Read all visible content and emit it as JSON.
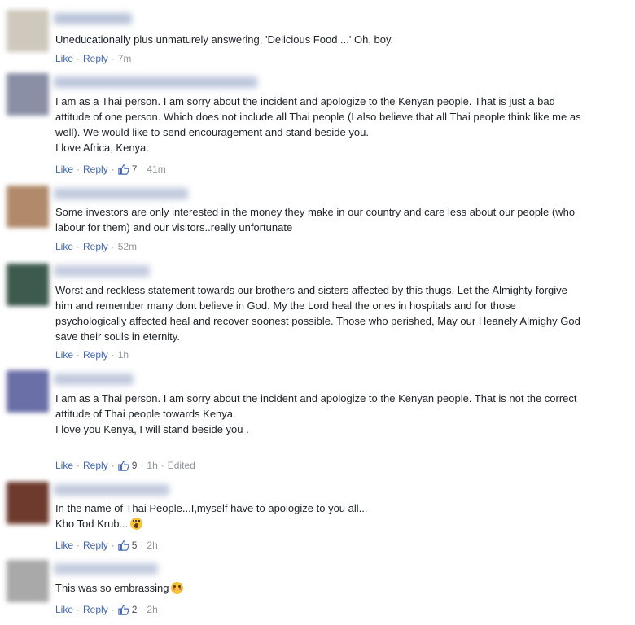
{
  "actions": {
    "like": "Like",
    "reply": "Reply",
    "separator": "·",
    "edited": "Edited"
  },
  "icons": {
    "like": "thumbs-up-icon"
  },
  "colors": {
    "link": "#4267b2",
    "meta": "#90949c",
    "text": "#1d2129"
  },
  "comments": [
    {
      "lines": [
        "Uneducationally plus unmaturely answering, 'Delicious Food ...' Oh, boy."
      ],
      "time": "7m",
      "likes": ""
    },
    {
      "lines": [
        "I am as a Thai person. I am sorry about the incident and apologize to the Kenyan people. That is just a bad",
        "attitude of one person. Which does not include all Thai people (I also believe that all Thai people think like me as",
        "well). We would like to send encouragement and stand beside you.",
        "I love Africa, Kenya."
      ],
      "time": "41m",
      "likes": "7"
    },
    {
      "lines": [
        "Some investors are only interested in the money they make in our country and care less about our people (who",
        "labour for them) and our visitors..really unfortunate"
      ],
      "time": "52m",
      "likes": ""
    },
    {
      "lines": [
        "Worst and reckless statement towards our brothers and sisters affected by this thugs. Let the Almighty forgive",
        "him and remember many dont believe in God. My the Lord heal the ones in hospitals and for those",
        "psychologically affected heal and recover soonest possible. Those who perished, May our Heanely Almighy God",
        "save their souls in eternity."
      ],
      "time": "1h",
      "likes": ""
    },
    {
      "lines": [
        "I am as a Thai person. I am sorry about the incident and apologize to the Kenyan people. That is not the correct",
        "attitude of Thai people towards Kenya.",
        "",
        "I love you Kenya, I will stand beside you ."
      ],
      "time": "1h",
      "likes": "9"
    },
    {
      "lines": [
        "In the name of Thai People...I,myself have to apologize to you all...",
        "Kho Tod Krub..."
      ],
      "emoji": "face-screaming-emoji",
      "time": "2h",
      "likes": "5"
    },
    {
      "lines": [
        "This was so embrassing"
      ],
      "emoji": "flushed-face-emoji",
      "time": "2h",
      "likes": "2"
    }
  ]
}
